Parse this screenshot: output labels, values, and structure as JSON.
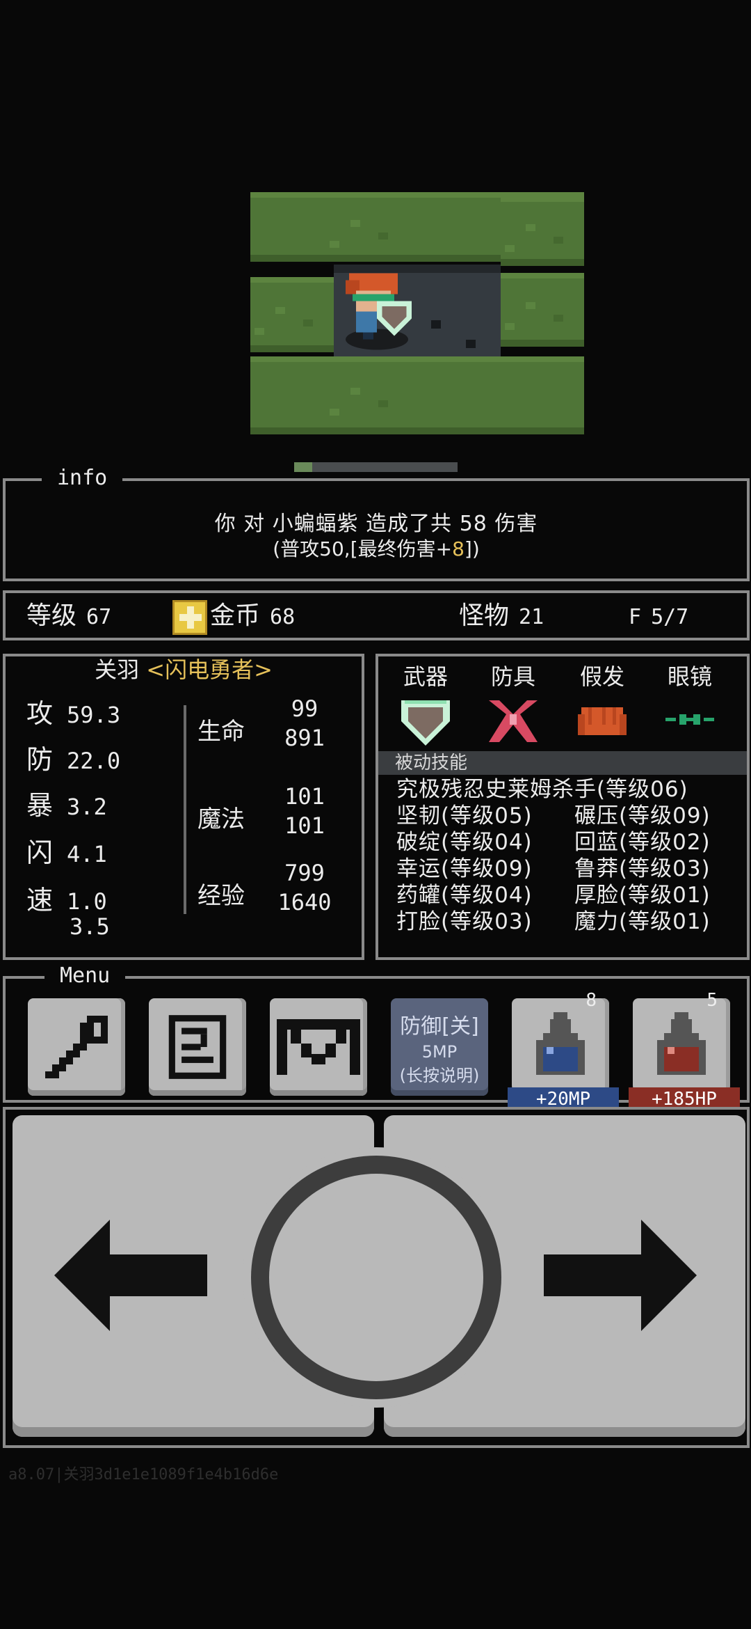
{
  "info": {
    "tab_label": "info",
    "message_line1": "你 对 小蝙蝠紫 造成了共 58 伤害",
    "message_line2_prefix": "(普攻50,[最终伤害+",
    "message_line2_value": "8",
    "message_line2_suffix": "])"
  },
  "floor_progress": 0.11,
  "status": {
    "level_label": "等级",
    "level_value": "67",
    "gold_label": "金币",
    "gold_value": "68",
    "monster_label": "怪物",
    "monster_value": "21",
    "floor_label": "F",
    "floor_value": "5/7"
  },
  "hero": {
    "name": "关羽",
    "title": "<闪电勇者>",
    "stats": [
      {
        "label": "攻",
        "value": "59.3"
      },
      {
        "label": "防",
        "value": "22.0"
      },
      {
        "label": "暴",
        "value": "3.2"
      },
      {
        "label": "闪",
        "value": "4.1"
      },
      {
        "label": "速",
        "value": "1.0",
        "value2": "3.5"
      }
    ],
    "hp_label": "生命",
    "hp_current": "99",
    "hp_max": "891",
    "mp_label": "魔法",
    "mp_current": "101",
    "mp_max": "101",
    "exp_label": "经验",
    "exp_current": "799",
    "exp_max": "1640"
  },
  "equipment": {
    "slots": [
      "武器",
      "防具",
      "假发",
      "眼镜"
    ],
    "icons": [
      "shield-gem-icon",
      "ribbon-armor-icon",
      "orange-wig-icon",
      "glasses-icon"
    ],
    "passive_header": "被动技能",
    "skills_full": "究极残忍史莱姆杀手(等级06)",
    "skills": [
      [
        "坚韧(等级05)",
        "碾压(等级09)"
      ],
      [
        "破绽(等级04)",
        "回蓝(等级02)"
      ],
      [
        "幸运(等级09)",
        "鲁莽(等级03)"
      ],
      [
        "药罐(等级04)",
        "厚脸(等级01)"
      ],
      [
        "打脸(等级03)",
        "魔力(等级01)"
      ]
    ]
  },
  "menu": {
    "tab_label": "Menu",
    "defend_line1": "防御[关]",
    "defend_line2": "5MP",
    "defend_line3": "(长按说明)",
    "mp_potion_count": "8",
    "mp_potion_label": "+20MP",
    "hp_potion_count": "5",
    "hp_potion_label": "+185HP"
  },
  "colors": {
    "accent_gold": "#e6c15a",
    "mp_blue": "#2d4a86",
    "hp_red": "#8a2e25"
  },
  "footer": "a8.07|关羽3d1e1e1089f1e4b16d6e"
}
